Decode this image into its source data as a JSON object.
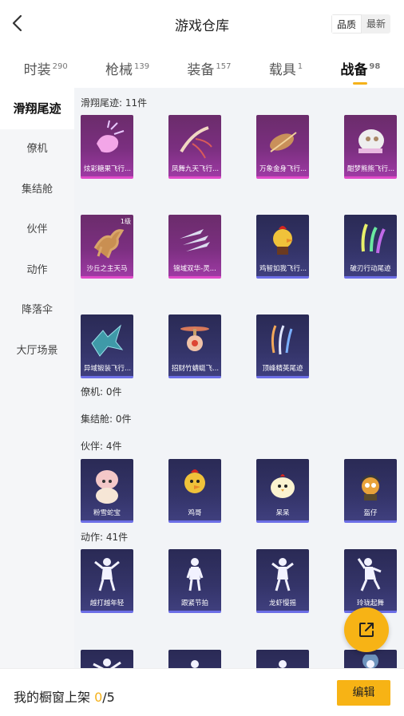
{
  "header": {
    "title": "游戏仓库",
    "sort_options": [
      "品质",
      "最新"
    ],
    "sort_active": 0
  },
  "tabs": [
    {
      "label": "时装",
      "count": "290"
    },
    {
      "label": "枪械",
      "count": "139"
    },
    {
      "label": "装备",
      "count": "157"
    },
    {
      "label": "载具",
      "count": "1"
    },
    {
      "label": "战备",
      "count": "98"
    }
  ],
  "sidebar": {
    "items": [
      "滑翔尾迹",
      "僚机",
      "集结舱",
      "伙伴",
      "动作",
      "降落伞",
      "大厅场景"
    ]
  },
  "sections": {
    "glide": {
      "title": "滑翔尾迹: 11件",
      "items": [
        {
          "name": "炫彩糖果飞行...",
          "rarity": "purple"
        },
        {
          "name": "凤舞九天飞行...",
          "rarity": "purple"
        },
        {
          "name": "万象金身飞行...",
          "rarity": "purple"
        },
        {
          "name": "酣梦熊熊飞行...",
          "rarity": "purple"
        },
        {
          "name": "沙丘之主天马",
          "rarity": "purple",
          "level": "1级"
        },
        {
          "name": "锦域双华-灵...",
          "rarity": "purple"
        },
        {
          "name": "鸡智如我飞行...",
          "rarity": "blue"
        },
        {
          "name": "破刃行动尾迹",
          "rarity": "blue"
        },
        {
          "name": "异域锻装飞行...",
          "rarity": "blue"
        },
        {
          "name": "招财竹蜻蜓飞...",
          "rarity": "blue"
        },
        {
          "name": "顶峰精英尾迹",
          "rarity": "blue"
        }
      ]
    },
    "wingman": {
      "title": "僚机: 0件"
    },
    "pod": {
      "title": "集结舱: 0件"
    },
    "partner": {
      "title": "伙伴: 4件",
      "items": [
        {
          "name": "粉雪蛇宝",
          "rarity": "blue"
        },
        {
          "name": "鸡哥",
          "rarity": "blue"
        },
        {
          "name": "呆呆",
          "rarity": "blue"
        },
        {
          "name": "盔仔",
          "rarity": "blue"
        }
      ]
    },
    "action": {
      "title": "动作: 41件",
      "items": [
        {
          "name": "越打越年轻",
          "rarity": "blue"
        },
        {
          "name": "跟紧节拍",
          "rarity": "blue"
        },
        {
          "name": "龙虾慢摇",
          "rarity": "blue"
        },
        {
          "name": "玲珑起舞",
          "rarity": "blue"
        }
      ]
    }
  },
  "bottom": {
    "showcase_label": "我的橱窗上架 ",
    "showcase_current": "0",
    "showcase_total": "/5",
    "edit_label": "编辑"
  },
  "colors": {
    "accent": "#f7b315",
    "purple_card": "#7b2f80",
    "blue_card": "#343469"
  },
  "icons": {
    "back": "chevron-left-icon",
    "share": "external-link-icon"
  }
}
